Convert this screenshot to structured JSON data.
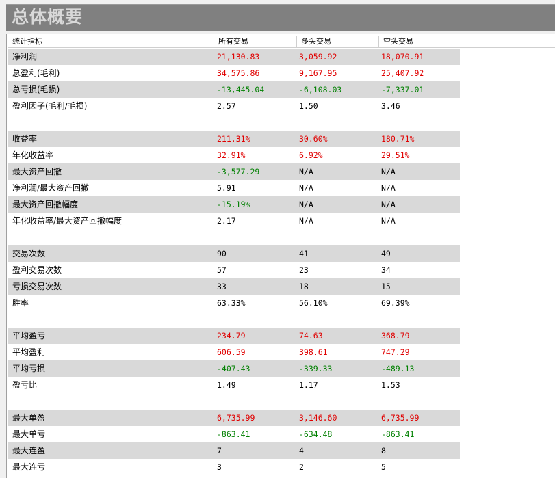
{
  "title": "总体概要",
  "colors": {
    "positive": "#e00000",
    "negative": "#008000",
    "neutral": "#000000"
  },
  "headers": [
    "统计指标",
    "所有交易",
    "多头交易",
    "空头交易"
  ],
  "rows": [
    {
      "label": "净利润",
      "values": [
        "21,130.83",
        "3,059.92",
        "18,070.91"
      ],
      "tone": "pos",
      "shade": true
    },
    {
      "label": "总盈利(毛利)",
      "values": [
        "34,575.86",
        "9,167.95",
        "25,407.92"
      ],
      "tone": "pos",
      "shade": false
    },
    {
      "label": "总亏损(毛损)",
      "values": [
        "-13,445.04",
        "-6,108.03",
        "-7,337.01"
      ],
      "tone": "neg",
      "shade": true
    },
    {
      "label": "盈利因子(毛利/毛损)",
      "values": [
        "2.57",
        "1.50",
        "3.46"
      ],
      "tone": "neu",
      "shade": false
    },
    {
      "blank": true
    },
    {
      "label": "收益率",
      "values": [
        "211.31%",
        "30.60%",
        "180.71%"
      ],
      "tone": "pos",
      "shade": true
    },
    {
      "label": "年化收益率",
      "values": [
        "32.91%",
        "6.92%",
        "29.51%"
      ],
      "tone": "pos",
      "shade": false
    },
    {
      "label": "最大资产回撤",
      "values": [
        "-3,577.29",
        "N/A",
        "N/A"
      ],
      "tones": [
        "neg",
        "neu",
        "neu"
      ],
      "shade": true
    },
    {
      "label": "净利润/最大资产回撤",
      "values": [
        "5.91",
        "N/A",
        "N/A"
      ],
      "tone": "neu",
      "shade": false
    },
    {
      "label": "最大资产回撤幅度",
      "values": [
        "-15.19%",
        "N/A",
        "N/A"
      ],
      "tones": [
        "neg",
        "neu",
        "neu"
      ],
      "shade": true
    },
    {
      "label": "年化收益率/最大资产回撤幅度",
      "values": [
        "2.17",
        "N/A",
        "N/A"
      ],
      "tone": "neu",
      "shade": false
    },
    {
      "blank": true
    },
    {
      "label": "交易次数",
      "values": [
        "90",
        "41",
        "49"
      ],
      "tone": "neu",
      "shade": true
    },
    {
      "label": "盈利交易次数",
      "values": [
        "57",
        "23",
        "34"
      ],
      "tone": "neu",
      "shade": false
    },
    {
      "label": "亏损交易次数",
      "values": [
        "33",
        "18",
        "15"
      ],
      "tone": "neu",
      "shade": true
    },
    {
      "label": "胜率",
      "values": [
        "63.33%",
        "56.10%",
        "69.39%"
      ],
      "tone": "neu",
      "shade": false
    },
    {
      "blank": true
    },
    {
      "label": "平均盈亏",
      "values": [
        "234.79",
        "74.63",
        "368.79"
      ],
      "tone": "pos",
      "shade": true
    },
    {
      "label": "平均盈利",
      "values": [
        "606.59",
        "398.61",
        "747.29"
      ],
      "tone": "pos",
      "shade": false
    },
    {
      "label": "平均亏损",
      "values": [
        "-407.43",
        "-339.33",
        "-489.13"
      ],
      "tone": "neg",
      "shade": true
    },
    {
      "label": "盈亏比",
      "values": [
        "1.49",
        "1.17",
        "1.53"
      ],
      "tone": "neu",
      "shade": false
    },
    {
      "blank": true
    },
    {
      "label": "最大单盈",
      "values": [
        "6,735.99",
        "3,146.60",
        "6,735.99"
      ],
      "tone": "pos",
      "shade": true
    },
    {
      "label": "最大单亏",
      "values": [
        "-863.41",
        "-634.48",
        "-863.41"
      ],
      "tone": "neg",
      "shade": false
    },
    {
      "label": "最大连盈",
      "values": [
        "7",
        "4",
        "8"
      ],
      "tone": "neu",
      "shade": true
    },
    {
      "label": "最大连亏",
      "values": [
        "3",
        "2",
        "5"
      ],
      "tone": "neu",
      "shade": false
    }
  ]
}
